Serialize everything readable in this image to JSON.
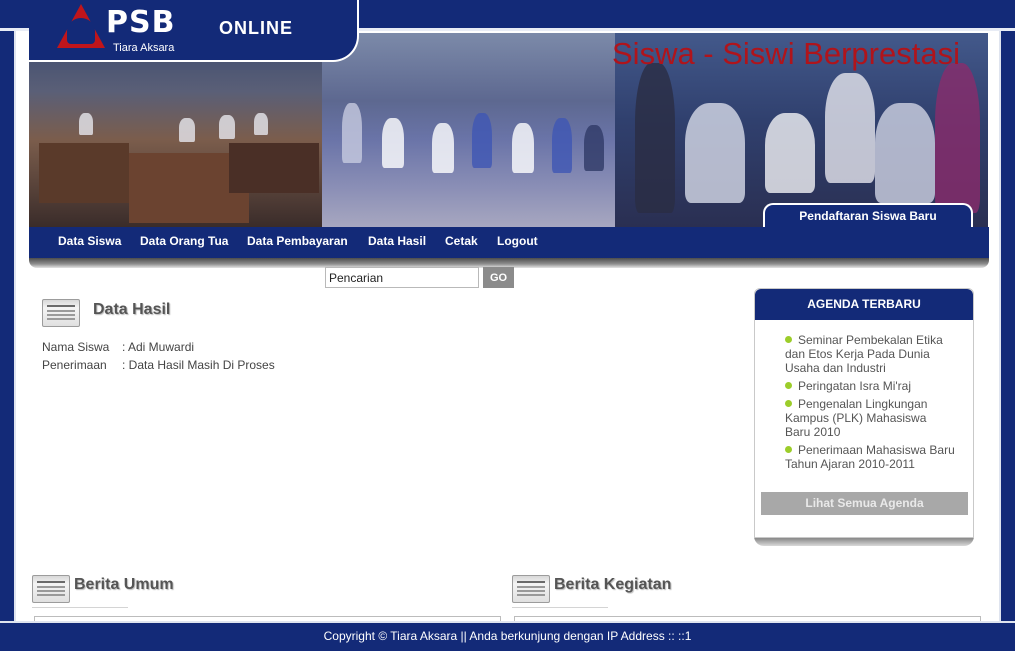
{
  "header": {
    "logo_text": "PSB",
    "logo_suffix": "ONLINE",
    "logo_subtitle": "Tiara Aksara",
    "logo_emblem_text": "TIARA AKSARA",
    "banner_title": "Siswa - Siswi Berprestasi",
    "register_tab": "Pendaftaran Siswa Baru"
  },
  "nav": {
    "items": [
      {
        "label": "Data Siswa"
      },
      {
        "label": "Data Orang Tua"
      },
      {
        "label": "Data Pembayaran"
      },
      {
        "label": "Data Hasil"
      },
      {
        "label": "Cetak"
      },
      {
        "label": "Logout"
      }
    ]
  },
  "search": {
    "value": "Pencarian",
    "button": "GO"
  },
  "main": {
    "title": "Data Hasil",
    "rows": [
      {
        "label": "Nama Siswa",
        "value": ": Adi Muwardi"
      },
      {
        "label": "Penerimaan",
        "value": ": Data Hasil Masih Di Proses"
      }
    ]
  },
  "agenda": {
    "title": "AGENDA TERBARU",
    "items": [
      "Seminar Pembekalan Etika dan Etos Kerja Pada Dunia Usaha dan Industri",
      "Peringatan Isra Mi'raj",
      "Pengenalan Lingkungan Kampus (PLK) Mahasiswa Baru 2010",
      "Penerimaan Mahasiswa Baru Tahun Ajaran 2010-2011"
    ],
    "button": "Lihat Semua Agenda"
  },
  "sections": {
    "berita_umum": "Berita Umum",
    "berita_kegiatan": "Berita Kegiatan"
  },
  "footer": {
    "text": "Copyright © Tiara Aksara || Anda berkunjung dengan IP Address :: ::1"
  },
  "colors": {
    "primary": "#132a78",
    "accent_red": "#b0141b",
    "bullet_green": "#9ccd2a"
  }
}
